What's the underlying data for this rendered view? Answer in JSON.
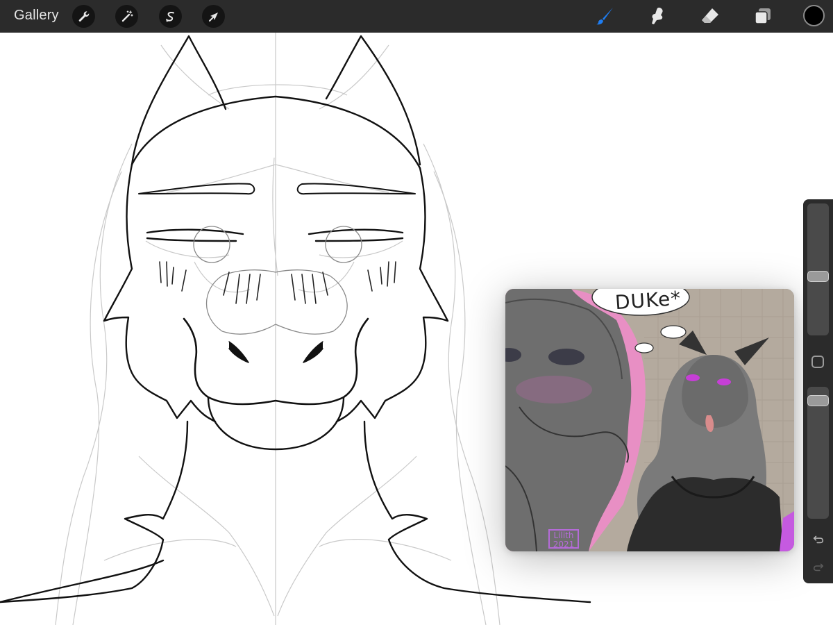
{
  "toolbar": {
    "gallery_label": "Gallery",
    "left_tools": [
      {
        "name": "actions",
        "icon": "wrench-icon"
      },
      {
        "name": "adjustments",
        "icon": "magic-wand-icon"
      },
      {
        "name": "selection",
        "icon": "selection-s-icon"
      },
      {
        "name": "transform",
        "icon": "arrow-cursor-icon"
      }
    ],
    "right_tools": [
      {
        "name": "brush",
        "icon": "brush-icon",
        "active": true
      },
      {
        "name": "smudge",
        "icon": "smudge-finger-icon"
      },
      {
        "name": "eraser",
        "icon": "eraser-icon"
      },
      {
        "name": "layers",
        "icon": "layers-icon"
      }
    ],
    "current_color": "#000000",
    "active_color": "#1e7df2"
  },
  "reference_window": {
    "thought_text": "DUKe*",
    "signature_text": "Lilith 2021"
  },
  "sidebar": {
    "brush_size_level": 0.44,
    "opacity_level": 0.07,
    "undo_icon": "undo-icon",
    "redo_icon": "redo-icon"
  }
}
